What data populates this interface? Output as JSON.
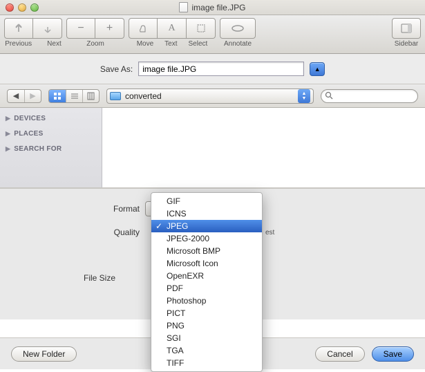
{
  "window": {
    "title": "image file.JPG"
  },
  "toolbar": {
    "previous": "Previous",
    "next": "Next",
    "zoom": "Zoom",
    "move": "Move",
    "text": "Text",
    "select": "Select",
    "annotate": "Annotate",
    "sidebar": "Sidebar"
  },
  "save_as": {
    "label": "Save As:",
    "value": "image file.JPG"
  },
  "browser": {
    "folder": "converted"
  },
  "sidebar": {
    "items": [
      {
        "label": "DEVICES"
      },
      {
        "label": "PLACES"
      },
      {
        "label": "SEARCH FOR"
      }
    ]
  },
  "options": {
    "format_label": "Format",
    "quality_label": "Quality",
    "filesize_label": "File Size",
    "quality_best": "est"
  },
  "format_menu": {
    "items": [
      "GIF",
      "ICNS",
      "JPEG",
      "JPEG-2000",
      "Microsoft BMP",
      "Microsoft Icon",
      "OpenEXR",
      "PDF",
      "Photoshop",
      "PICT",
      "PNG",
      "SGI",
      "TGA",
      "TIFF"
    ],
    "selected": "JPEG"
  },
  "buttons": {
    "new_folder": "New Folder",
    "cancel": "Cancel",
    "save": "Save"
  }
}
